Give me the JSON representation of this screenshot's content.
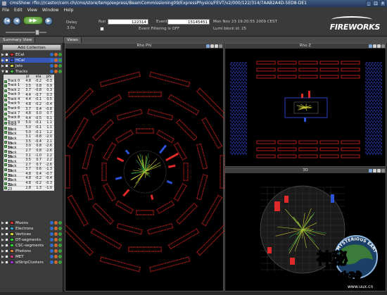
{
  "window": {
    "title": "cmsShow: rfio:///castor/cern.ch/cms/store/temp/express/BeamCommissioning09/ExpressPhysics/FEVT/v2/000/122/314/7AAB2A4D-5ED8-DE1",
    "min": "_",
    "max": "□",
    "close": "x"
  },
  "menu": [
    "File",
    "Edit",
    "View",
    "Window",
    "Help"
  ],
  "toolbar": {
    "first": "|◀",
    "prev": "◀",
    "play": "▶▶",
    "next": "▶",
    "last": "▶|",
    "delay_label": "Delay",
    "delay_value": "3.0s",
    "run_label": "Run",
    "run_value": "122314",
    "event_label": "Event",
    "event_value": "15145451",
    "filter_label": "Event Filtering is OFF",
    "datetime": "Mon Nov 23 19:20:55 2009 CEST",
    "lumi": "Lumi block id: 25",
    "logo": "FIREWORKS"
  },
  "tabs": {
    "left": "Summary View",
    "right": "Views"
  },
  "panel": {
    "add_button": "Add Collection",
    "collections_top": [
      {
        "label": "ECal",
        "color": "#c83030"
      },
      {
        "label": "HCal",
        "color": "#3050c8",
        "selected": true
      },
      {
        "label": "Jets",
        "color": "#c8c830"
      },
      {
        "label": "Tracks",
        "color": "#40b040"
      }
    ],
    "columns": [
      "pt",
      "eta",
      "phi"
    ],
    "tracks": [
      {
        "name": "Track 0",
        "pt": "4.8",
        "eta": "-0.2",
        "phi": "-0.3"
      },
      {
        "name": "Track 1",
        "pt": "3.5",
        "eta": "0.8",
        "phi": "0.9"
      },
      {
        "name": "Track 2",
        "pt": "3.7",
        "eta": "-0.8",
        "phi": "0.3"
      },
      {
        "name": "Track 3",
        "pt": "4.4",
        "eta": "-0.7",
        "phi": "0.3"
      },
      {
        "name": "Track 4",
        "pt": "4.4",
        "eta": "-0.1",
        "phi": "0.5"
      },
      {
        "name": "Track 5",
        "pt": "4.8",
        "eta": "-0.2",
        "phi": "-0.4"
      },
      {
        "name": "Track 6",
        "pt": "3.7",
        "eta": "0.4",
        "phi": "-0.8"
      },
      {
        "name": "Track 7",
        "pt": "4.8",
        "eta": "0.0",
        "phi": "0.7"
      },
      {
        "name": "Track 8",
        "pt": "4.4",
        "eta": "-0.5",
        "phi": "0.1"
      },
      {
        "name": "Track 9",
        "pt": "5.0",
        "eta": "-0.1",
        "phi": "1.1"
      },
      {
        "name": "Track 10",
        "pt": "5.0",
        "eta": "-0.1",
        "phi": "1.1"
      },
      {
        "name": "Track 11",
        "pt": "5.0",
        "eta": "-0.1",
        "phi": "1.2"
      },
      {
        "name": "Track 12",
        "pt": "3.1",
        "eta": "-0.8",
        "phi": "-2.0"
      },
      {
        "name": "Track 13",
        "pt": "3.5",
        "eta": "-0.4",
        "phi": "2.1"
      },
      {
        "name": "Track 14",
        "pt": "3.0",
        "eta": "0.8",
        "phi": "-2.6"
      },
      {
        "name": "Track 15",
        "pt": "2.7",
        "eta": "0.8",
        "phi": "-2.6"
      },
      {
        "name": "Track 16",
        "pt": "3.1",
        "eta": "-1.0",
        "phi": "2.2"
      },
      {
        "name": "Track 17",
        "pt": "3.5",
        "eta": "0.7",
        "phi": "2.2"
      },
      {
        "name": "Track 18",
        "pt": "2.7",
        "eta": "0.7",
        "phi": "-2.6"
      },
      {
        "name": "Track 19",
        "pt": "3.7",
        "eta": "0.6",
        "phi": "-1.3"
      },
      {
        "name": "Track 20",
        "pt": "4.8",
        "eta": "0.4",
        "phi": "-0.7"
      },
      {
        "name": "Track 21",
        "pt": "4.8",
        "eta": "-0.2",
        "phi": "-0.4"
      },
      {
        "name": "Track 22",
        "pt": "4.8",
        "eta": "-0.2",
        "phi": "-0.3"
      },
      {
        "name": "Track 23",
        "pt": "2.8",
        "eta": "1.3",
        "phi": "-1.0"
      }
    ],
    "collections_bottom": [
      {
        "label": "Muons",
        "color": "#d03030"
      },
      {
        "label": "Electrons",
        "color": "#30a0d0"
      },
      {
        "label": "Vertices",
        "color": "#d0d030"
      },
      {
        "label": "DT-segments",
        "color": "#30d030"
      },
      {
        "label": "CSC-segments",
        "color": "#30d030"
      },
      {
        "label": "Photons",
        "color": "#d08030"
      },
      {
        "label": "MET",
        "color": "#d03080"
      },
      {
        "label": "siStripClusters",
        "color": "#a030d0"
      }
    ]
  },
  "views": {
    "rhophi": "Rho Phi",
    "rhoz": "Rho Z",
    "threed": "3D"
  },
  "watermark": {
    "top": "MYSTERIOUS EARTH",
    "cn1": "神秘",
    "cn2": "的地球",
    "url": "www.uux.cn"
  }
}
